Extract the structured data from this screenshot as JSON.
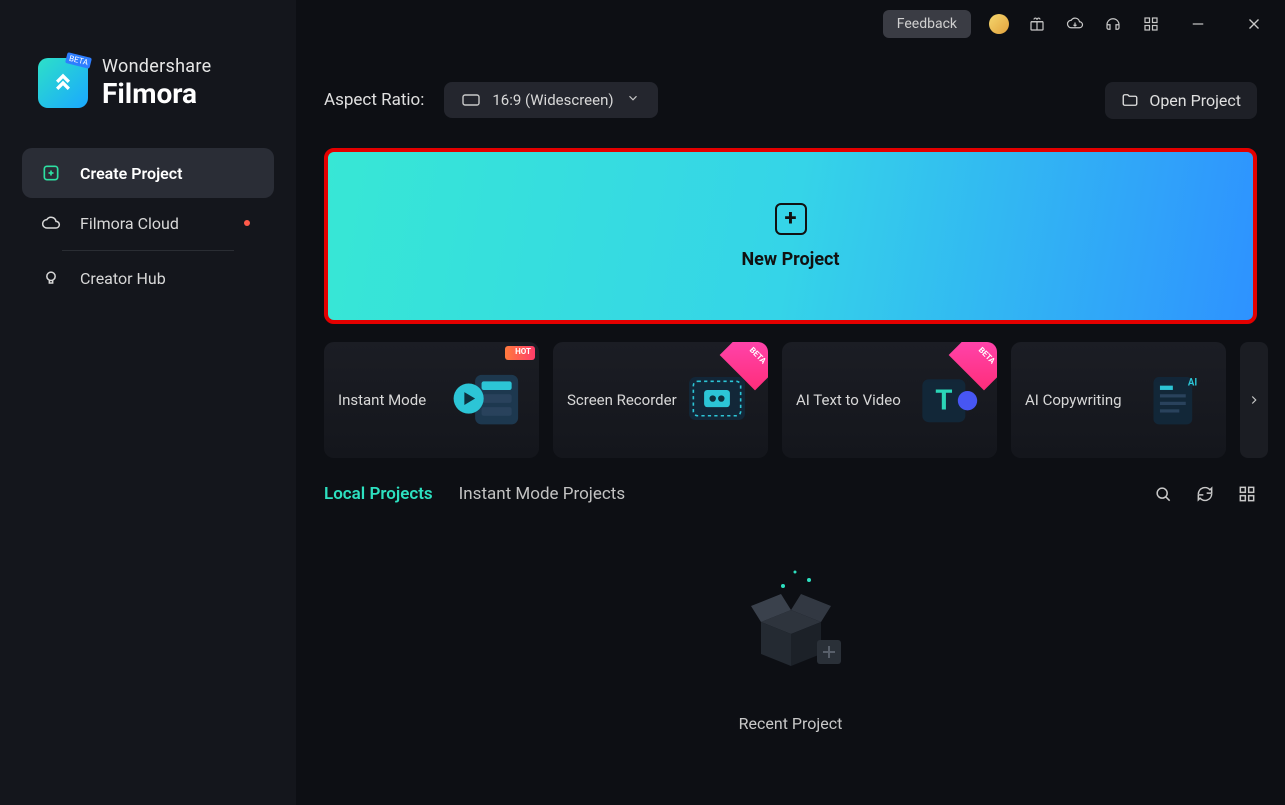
{
  "titlebar": {
    "feedback_label": "Feedback"
  },
  "brand": {
    "line1": "Wondershare",
    "line2": "Filmora",
    "beta": "BETA"
  },
  "sidebar": {
    "items": [
      {
        "label": "Create Project"
      },
      {
        "label": "Filmora Cloud"
      },
      {
        "label": "Creator Hub"
      }
    ]
  },
  "toprow": {
    "ratio_label": "Aspect Ratio:",
    "ratio_value": "16:9 (Widescreen)",
    "open_project": "Open Project"
  },
  "new_project": {
    "label": "New Project"
  },
  "features": [
    {
      "label": "Instant Mode",
      "badge": "hot"
    },
    {
      "label": "Screen Recorder",
      "badge": "beta"
    },
    {
      "label": "AI Text to Video",
      "badge": "beta"
    },
    {
      "label": "AI Copywriting",
      "badge": ""
    }
  ],
  "tabs": {
    "local": "Local Projects",
    "instant": "Instant Mode Projects"
  },
  "recent": {
    "label": "Recent Project"
  }
}
